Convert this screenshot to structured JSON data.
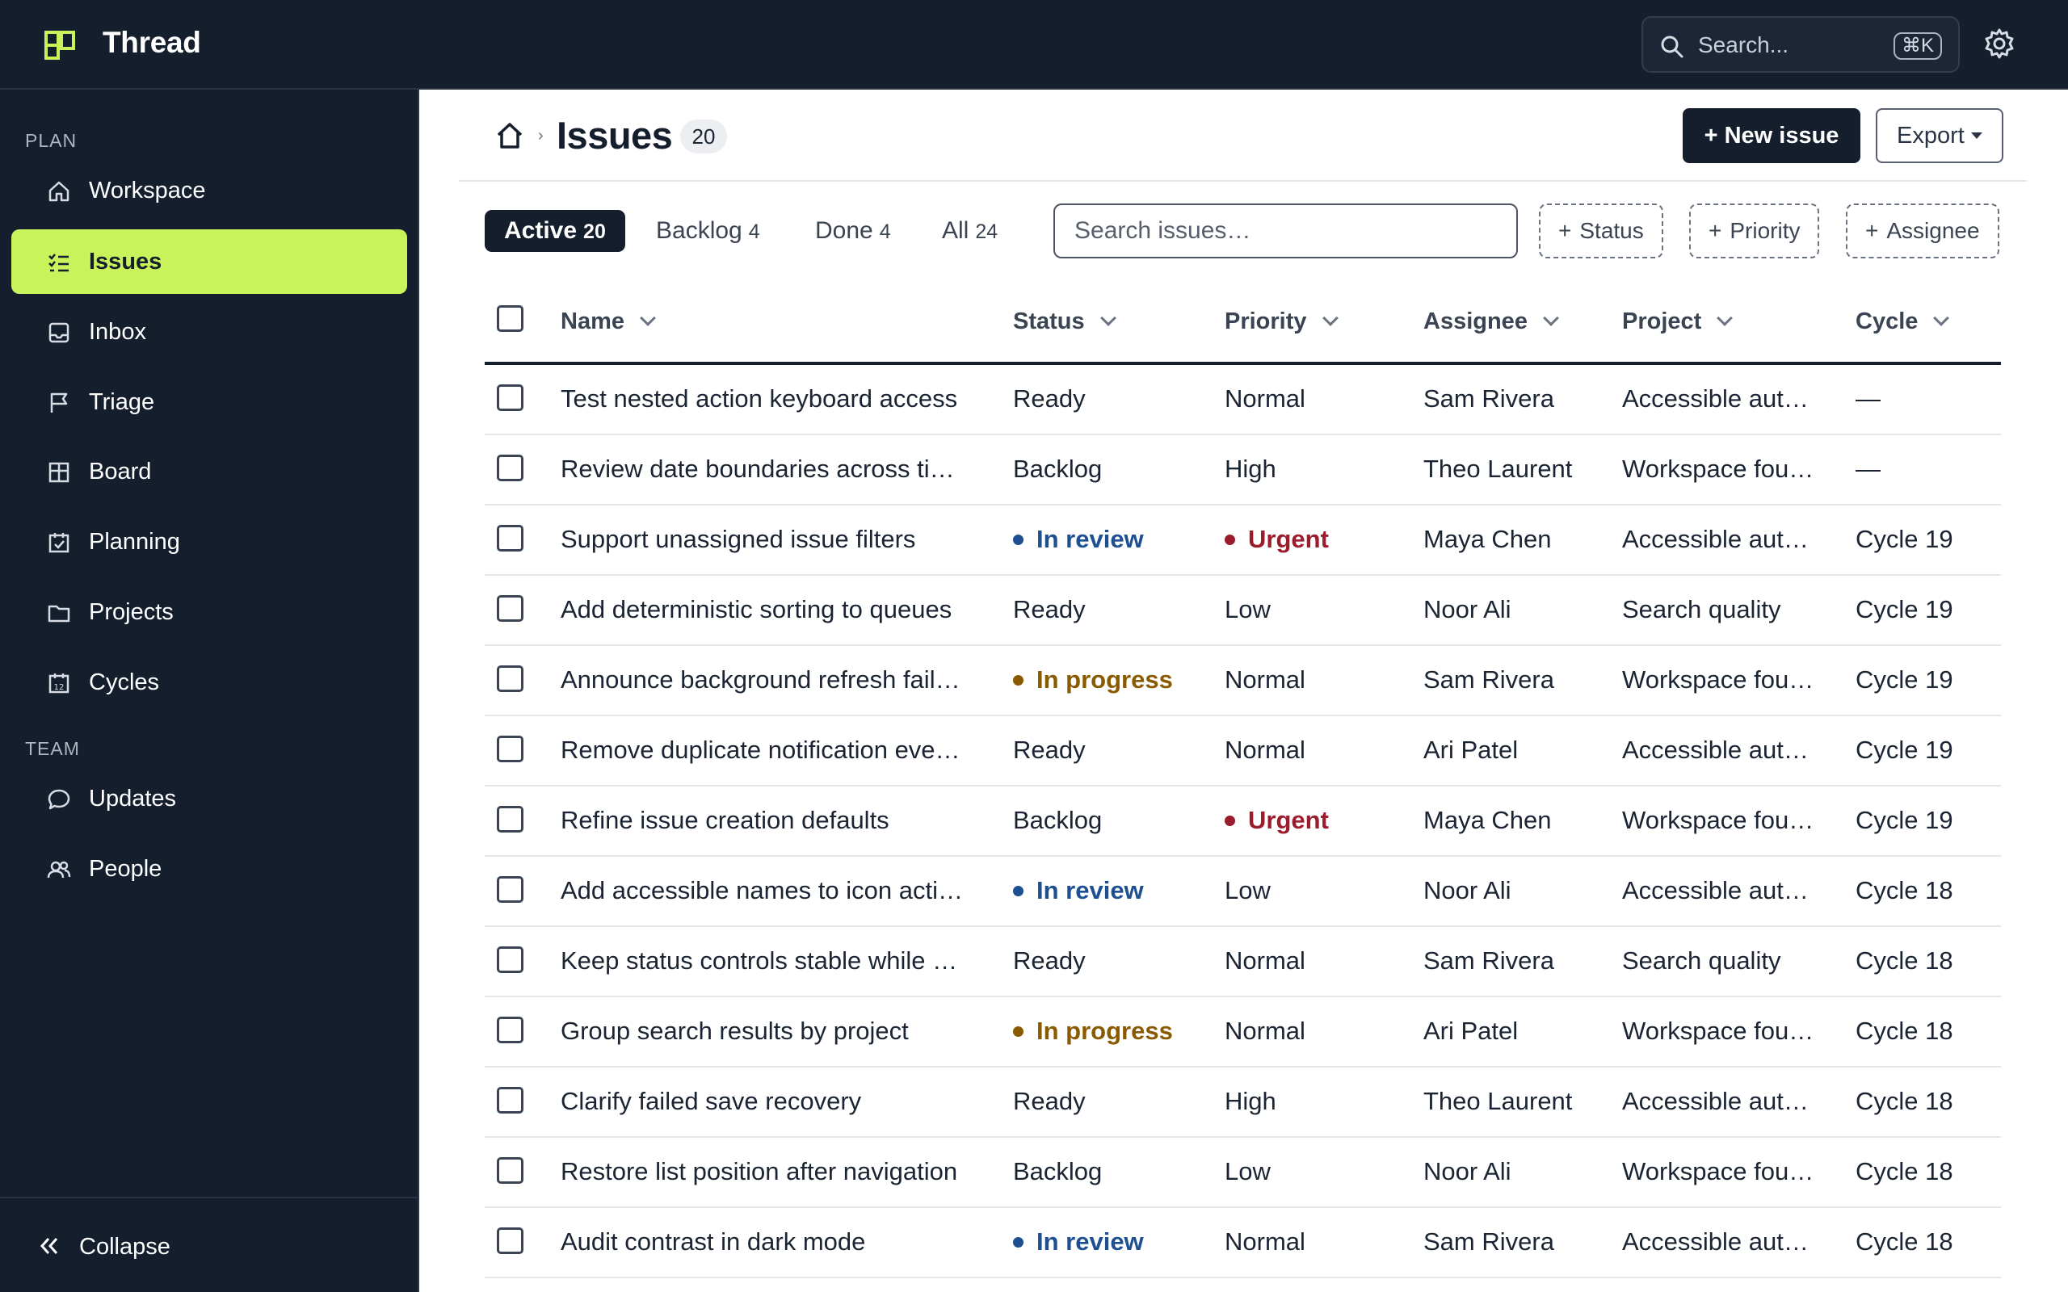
{
  "app": {
    "title": "Thread",
    "accent": "#c8f35b",
    "bg_dark": "#151e2d"
  },
  "topbar": {
    "search_placeholder": "Search...",
    "search_shortcut": "⌘K"
  },
  "sidebar": {
    "sections": {
      "plan": "PLAN",
      "team": "TEAM"
    },
    "items": [
      {
        "label": "Workspace",
        "icon": "home-icon"
      },
      {
        "label": "Issues",
        "icon": "list-check-icon",
        "active": true
      },
      {
        "label": "Inbox",
        "icon": "inbox-icon"
      },
      {
        "label": "Triage",
        "icon": "flag-icon"
      },
      {
        "label": "Board",
        "icon": "board-icon"
      },
      {
        "label": "Planning",
        "icon": "calendar-check-icon"
      },
      {
        "label": "Projects",
        "icon": "folder-icon"
      },
      {
        "label": "Cycles",
        "icon": "calendar-12-icon"
      },
      {
        "label": "Updates",
        "icon": "chat-bubble-icon"
      },
      {
        "label": "People",
        "icon": "people-icon"
      }
    ],
    "collapse_label": "Collapse"
  },
  "header": {
    "title": "Issues",
    "count": "20",
    "new_issue_label": "+ New issue",
    "export_label": "Export"
  },
  "tabs": [
    {
      "label": "Active",
      "count": "20",
      "active": true
    },
    {
      "label": "Backlog",
      "count": "4"
    },
    {
      "label": "Done",
      "count": "4"
    },
    {
      "label": "All",
      "count": "24"
    }
  ],
  "issue_search": {
    "placeholder": "Search issues…"
  },
  "filters": {
    "status": "Status",
    "priority": "Priority",
    "assignee": "Assignee",
    "plus": "+"
  },
  "table": {
    "columns": {
      "name": "Name",
      "status": "Status",
      "priority": "Priority",
      "assignee": "Assignee",
      "project": "Project",
      "cycle": "Cycle"
    },
    "rows": [
      {
        "name": "Test nested action keyboard access",
        "status": "Ready",
        "priority": "Normal",
        "assignee": "Sam Rivera",
        "project": "Accessible aut…",
        "cycle": "—"
      },
      {
        "name": "Review date boundaries across ti…",
        "status": "Backlog",
        "priority": "High",
        "assignee": "Theo Laurent",
        "project": "Workspace fou…",
        "cycle": "—"
      },
      {
        "name": "Support unassigned issue filters",
        "status": "In review",
        "priority": "Urgent",
        "assignee": "Maya Chen",
        "project": "Accessible aut…",
        "cycle": "Cycle 19"
      },
      {
        "name": "Add deterministic sorting to queues",
        "status": "Ready",
        "priority": "Low",
        "assignee": "Noor Ali",
        "project": "Search quality",
        "cycle": "Cycle 19"
      },
      {
        "name": "Announce background refresh fail…",
        "status": "In progress",
        "priority": "Normal",
        "assignee": "Sam Rivera",
        "project": "Workspace fou…",
        "cycle": "Cycle 19"
      },
      {
        "name": "Remove duplicate notification eve…",
        "status": "Ready",
        "priority": "Normal",
        "assignee": "Ari Patel",
        "project": "Accessible aut…",
        "cycle": "Cycle 19"
      },
      {
        "name": "Refine issue creation defaults",
        "status": "Backlog",
        "priority": "Urgent",
        "assignee": "Maya Chen",
        "project": "Workspace fou…",
        "cycle": "Cycle 19"
      },
      {
        "name": "Add accessible names to icon acti…",
        "status": "In review",
        "priority": "Low",
        "assignee": "Noor Ali",
        "project": "Accessible aut…",
        "cycle": "Cycle 18"
      },
      {
        "name": "Keep status controls stable while …",
        "status": "Ready",
        "priority": "Normal",
        "assignee": "Sam Rivera",
        "project": "Search quality",
        "cycle": "Cycle 18"
      },
      {
        "name": "Group search results by project",
        "status": "In progress",
        "priority": "Normal",
        "assignee": "Ari Patel",
        "project": "Workspace fou…",
        "cycle": "Cycle 18"
      },
      {
        "name": "Clarify failed save recovery",
        "status": "Ready",
        "priority": "High",
        "assignee": "Theo Laurent",
        "project": "Accessible aut…",
        "cycle": "Cycle 18"
      },
      {
        "name": "Restore list position after navigation",
        "status": "Backlog",
        "priority": "Low",
        "assignee": "Noor Ali",
        "project": "Workspace fou…",
        "cycle": "Cycle 18"
      },
      {
        "name": "Audit contrast in dark mode",
        "status": "In review",
        "priority": "Normal",
        "assignee": "Sam Rivera",
        "project": "Accessible aut…",
        "cycle": "Cycle 18"
      }
    ]
  }
}
